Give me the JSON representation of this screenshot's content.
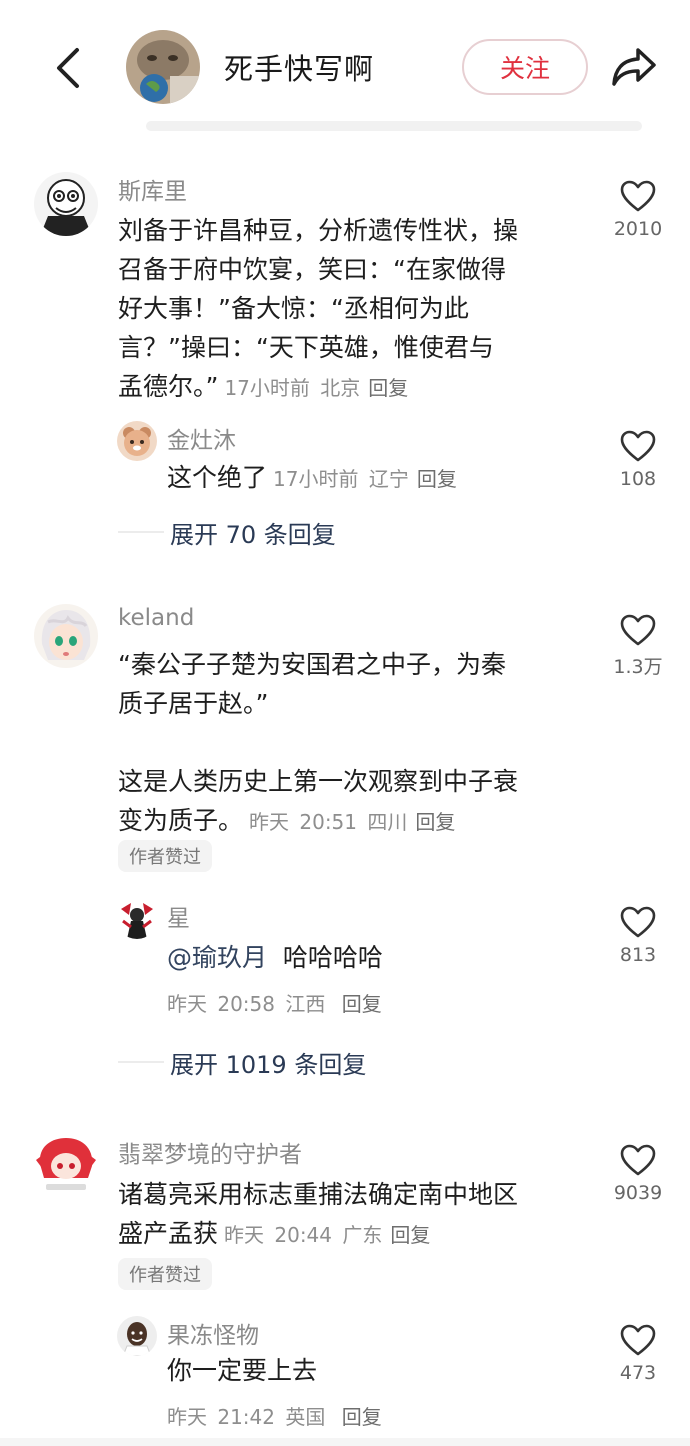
{
  "header": {
    "title": "死手快写啊",
    "follow_label": "关注"
  },
  "comments": [
    {
      "user": "斯库里",
      "text": "刘备于许昌种豆，分析遗传性状，操召备于府中饮宴，笑曰：“在家做得好大事！”备大惊：“丞相何为此言？”操曰：“天下英雄，惟使君与孟德尔。”",
      "line1": "刘备于许昌种豆，分析遗传性状，操",
      "line2": "召备于府中饮宴，笑曰：“在家做得",
      "line3": "好大事！”备大惊：“丞相何为此",
      "line4": "言？”操曰：“天下英雄，惟使君与",
      "line5": "孟德尔。”",
      "time": "17小时前",
      "location": "北京",
      "reply_label": "回复",
      "likes": "2010",
      "reply": {
        "user": "金灶沐",
        "text": "这个绝了",
        "time": "17小时前",
        "location": "辽宁",
        "reply_label": "回复",
        "likes": "108"
      },
      "expand": "展开 70 条回复"
    },
    {
      "user": "keland",
      "line1": "“秦公子子楚为安国君之中子，为秦",
      "line2": "质子居于赵。”",
      "line3": "这是人类历史上第一次观察到中子衰",
      "line4": "变为质子。",
      "time": "昨天 20:51",
      "location": "四川",
      "reply_label": "回复",
      "likes": "1.3万",
      "badge": "作者赞过",
      "reply": {
        "user": "星",
        "mention": "@瑜玖月",
        "text": "哈哈哈哈",
        "time": "昨天 20:58",
        "location": "江西",
        "reply_label": "回复",
        "likes": "813"
      },
      "expand": "展开 1019 条回复"
    },
    {
      "user": "翡翠梦境的守护者",
      "line1": "诸葛亮采用标志重捕法确定南中地区",
      "line2": "盛产孟获",
      "time": "昨天 20:44",
      "location": "广东",
      "reply_label": "回复",
      "likes": "9039",
      "badge": "作者赞过",
      "reply": {
        "user": "果冻怪物",
        "text": "你一定要上去",
        "time": "昨天 21:42",
        "location": "英国",
        "reply_label": "回复",
        "likes": "473"
      }
    }
  ],
  "colors": {
    "accent": "#e0313f",
    "text": "#1e1e1e",
    "meta": "#8e8e8e",
    "link": "#2a3a55"
  },
  "icons": [
    "back-arrow-icon",
    "share-icon",
    "heart-icon"
  ]
}
